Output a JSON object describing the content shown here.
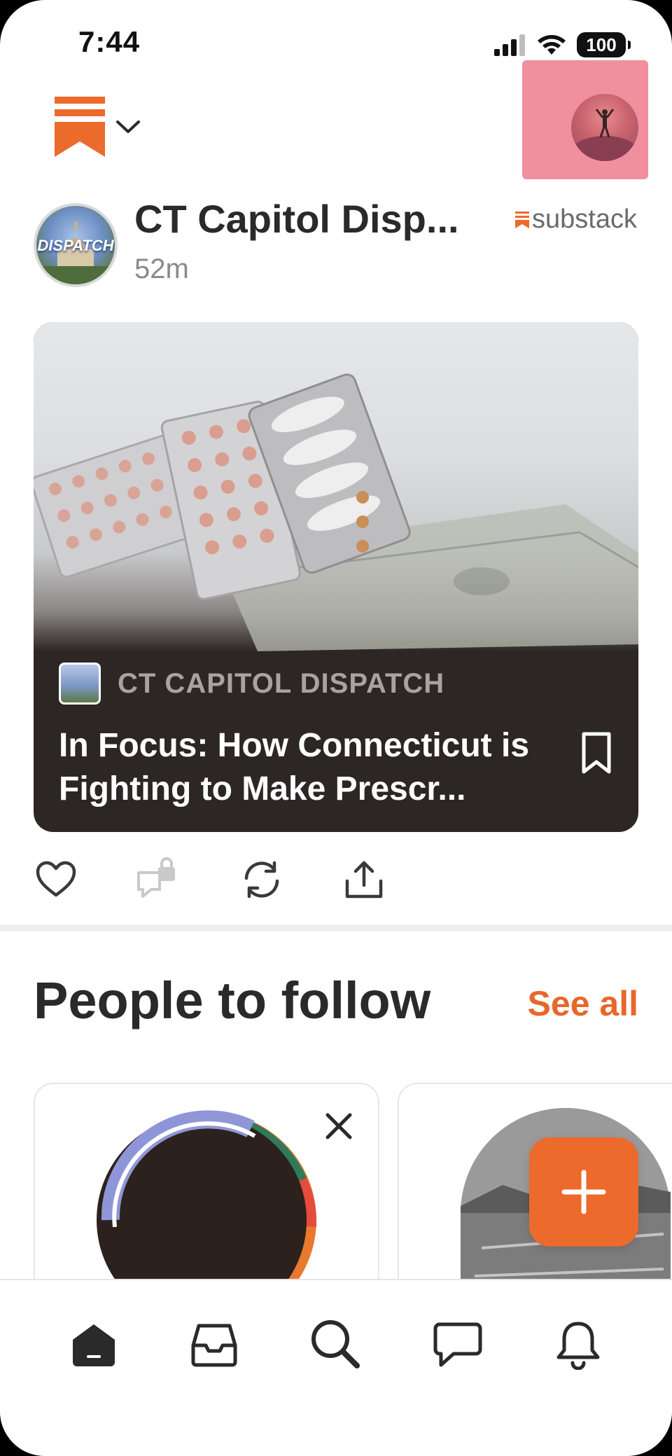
{
  "status_bar": {
    "time": "7:44",
    "battery": "100",
    "icons": [
      "cellular-signal-icon",
      "wifi-icon",
      "battery-icon"
    ]
  },
  "top_nav": {
    "logo": "substack-logo-icon",
    "menu_icon": "chevron-down-icon",
    "profile_avatar": "profile-avatar"
  },
  "post": {
    "publication_name": "CT Capitol Disp...",
    "avatar_text": "DISPATCH",
    "time_ago": "52m",
    "platform_label": "substack",
    "card": {
      "publication": "CT CAPITOL DISPATCH",
      "title": "In Focus: How Connecticut is Fighting to Make Prescr..."
    },
    "actions": [
      "heart-icon",
      "comment-locked-icon",
      "restack-icon",
      "share-icon"
    ]
  },
  "people_to_follow": {
    "title": "People to follow",
    "see_all": "See all"
  },
  "fab_icon": "plus-icon",
  "tabbar": {
    "items": [
      "home-icon",
      "inbox-icon",
      "search-icon",
      "chat-icon",
      "bell-icon"
    ]
  },
  "colors": {
    "accent": "#e8672a",
    "fab": "#ec6a2c",
    "card_bg": "#2c2624",
    "card_title": "#ffffff",
    "profile_highlight": "#f0909e"
  }
}
